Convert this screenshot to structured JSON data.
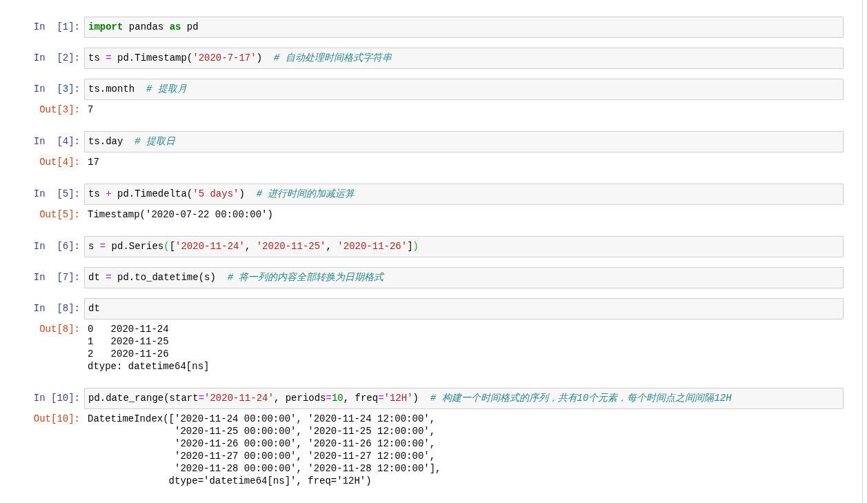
{
  "cells": [
    {
      "prompt": "In  [1]:",
      "code": [
        {
          "kind": "keyword",
          "text": "import"
        },
        {
          "kind": "name",
          "text": " pandas "
        },
        {
          "kind": "keyword",
          "text": "as"
        },
        {
          "kind": "name",
          "text": " pd"
        }
      ]
    },
    {
      "prompt": "In  [2]:",
      "code": [
        {
          "kind": "name",
          "text": "ts "
        },
        {
          "kind": "operator",
          "text": "="
        },
        {
          "kind": "name",
          "text": " pd.Timestamp("
        },
        {
          "kind": "string",
          "text": "'2020-7-17'"
        },
        {
          "kind": "name",
          "text": ")  "
        },
        {
          "kind": "comment",
          "text": "# 自动处理时间格式字符串"
        }
      ]
    },
    {
      "prompt": "In  [3]:",
      "code": [
        {
          "kind": "name",
          "text": "ts.month  "
        },
        {
          "kind": "comment",
          "text": "# 提取月"
        }
      ],
      "out_prompt": "Out[3]:",
      "output": [
        "7"
      ]
    },
    {
      "prompt": "In  [4]:",
      "code": [
        {
          "kind": "name",
          "text": "ts.day  "
        },
        {
          "kind": "comment",
          "text": "# 提取日"
        }
      ],
      "out_prompt": "Out[4]:",
      "output": [
        "17"
      ]
    },
    {
      "prompt": "In  [5]:",
      "code": [
        {
          "kind": "name",
          "text": "ts "
        },
        {
          "kind": "operator",
          "text": "+"
        },
        {
          "kind": "name",
          "text": " pd.Timedelta("
        },
        {
          "kind": "string",
          "text": "'5 days'"
        },
        {
          "kind": "name",
          "text": ")  "
        },
        {
          "kind": "comment",
          "text": "# 进行时间的加减运算"
        }
      ],
      "out_prompt": "Out[5]:",
      "output": [
        "Timestamp('2020-07-22 00:00:00')"
      ]
    },
    {
      "prompt": "In  [6]:",
      "code": [
        {
          "kind": "name",
          "text": "s "
        },
        {
          "kind": "operator",
          "text": "="
        },
        {
          "kind": "name",
          "text": " pd.Series"
        },
        {
          "kind": "bracket",
          "text": "("
        },
        {
          "kind": "name",
          "text": "["
        },
        {
          "kind": "string",
          "text": "'2020-11-24'"
        },
        {
          "kind": "name",
          "text": ", "
        },
        {
          "kind": "string",
          "text": "'2020-11-25'"
        },
        {
          "kind": "name",
          "text": ", "
        },
        {
          "kind": "string",
          "text": "'2020-11-26'"
        },
        {
          "kind": "name",
          "text": "]"
        },
        {
          "kind": "bracket",
          "text": ")"
        }
      ]
    },
    {
      "prompt": "In  [7]:",
      "code": [
        {
          "kind": "name",
          "text": "dt "
        },
        {
          "kind": "operator",
          "text": "="
        },
        {
          "kind": "name",
          "text": " pd.to_datetime(s)  "
        },
        {
          "kind": "comment",
          "text": "# 将一列的内容全部转换为日期格式"
        }
      ]
    },
    {
      "prompt": "In  [8]:",
      "code": [
        {
          "kind": "name",
          "text": "dt"
        }
      ],
      "out_prompt": "Out[8]:",
      "output": [
        "0   2020-11-24",
        "1   2020-11-25",
        "2   2020-11-26",
        "dtype: datetime64[ns]"
      ]
    },
    {
      "prompt": "In [10]:",
      "code": [
        {
          "kind": "name",
          "text": "pd.date_range(start"
        },
        {
          "kind": "operator",
          "text": "="
        },
        {
          "kind": "string",
          "text": "'2020-11-24'"
        },
        {
          "kind": "name",
          "text": ", periods"
        },
        {
          "kind": "operator",
          "text": "="
        },
        {
          "kind": "number",
          "text": "10"
        },
        {
          "kind": "name",
          "text": ", freq"
        },
        {
          "kind": "operator",
          "text": "="
        },
        {
          "kind": "string",
          "text": "'12H'"
        },
        {
          "kind": "name",
          "text": ")  "
        },
        {
          "kind": "comment",
          "text": "# 构建一个时间格式的序列，共有10个元素，每个时间点之间间隔12H"
        }
      ],
      "out_prompt": "Out[10]:",
      "output": [
        "DatetimeIndex(['2020-11-24 00:00:00', '2020-11-24 12:00:00',",
        "               '2020-11-25 00:00:00', '2020-11-25 12:00:00',",
        "               '2020-11-26 00:00:00', '2020-11-26 12:00:00',",
        "               '2020-11-27 00:00:00', '2020-11-27 12:00:00',",
        "               '2020-11-28 00:00:00', '2020-11-28 12:00:00'],",
        "              dtype='datetime64[ns]', freq='12H')"
      ]
    }
  ]
}
